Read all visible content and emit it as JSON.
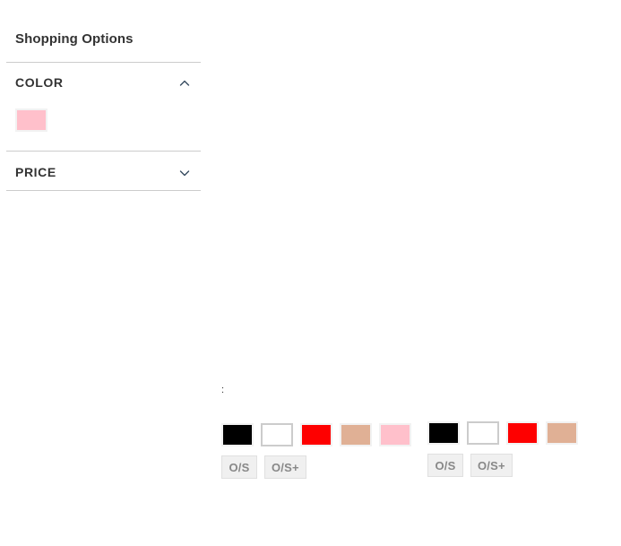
{
  "sidebar": {
    "title": "Shopping Options",
    "sections": [
      {
        "label": "COLOR",
        "chevron_icon": "chevron-up-icon",
        "expanded": true,
        "swatches": [
          {
            "name": "Pink",
            "hex": "#ffc0cb"
          }
        ]
      },
      {
        "label": "PRICE",
        "chevron_icon": "chevron-down-icon",
        "expanded": false,
        "swatches": []
      }
    ]
  },
  "products": [
    {
      "id": "product-left",
      "stray_text": ":",
      "color_swatches": [
        {
          "name": "Black",
          "hex": "#000000"
        },
        {
          "name": "White",
          "hex": "#ffffff"
        },
        {
          "name": "Red",
          "hex": "#fe0000"
        },
        {
          "name": "Nude",
          "hex": "#e0b095"
        },
        {
          "name": "Pink",
          "hex": "#ffc0cb"
        }
      ],
      "size_swatches": [
        {
          "label": "O/S"
        },
        {
          "label": "O/S+"
        }
      ]
    },
    {
      "id": "product-right",
      "stray_text": "",
      "color_swatches": [
        {
          "name": "Black",
          "hex": "#000000"
        },
        {
          "name": "White",
          "hex": "#ffffff"
        },
        {
          "name": "Red",
          "hex": "#fe0000"
        },
        {
          "name": "Nude",
          "hex": "#e0b095"
        }
      ],
      "size_swatches": [
        {
          "label": "O/S"
        },
        {
          "label": "O/S+"
        }
      ]
    }
  ],
  "colors": {
    "text": "#333333",
    "divider": "#cccccc",
    "swatch_frame": "#f2f2f2",
    "size_bg": "#f0f0f0",
    "size_border": "#e0e0e0",
    "size_text": "#888888",
    "chevron": "#34495e"
  }
}
